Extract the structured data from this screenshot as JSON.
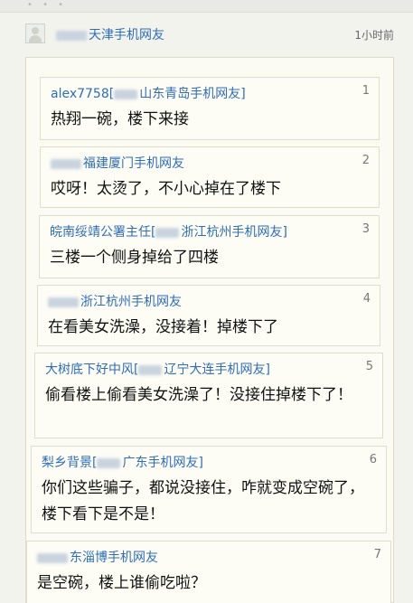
{
  "post": {
    "poster": "天津手机网友",
    "time": "1小时前"
  },
  "comments": [
    {
      "name_prefix": "alex7758[",
      "name_main": "山东青岛手机网友]",
      "number": "1",
      "text": "热翔一碗，楼下来接"
    },
    {
      "name_prefix": "",
      "name_main": "福建厦门手机网友",
      "number": "2",
      "text": "哎呀！太烫了，不小心掉在了楼下"
    },
    {
      "name_prefix": "皖南绥靖公署主任[",
      "name_main": "浙江杭州手机网友]",
      "number": "3",
      "text": "三楼一个侧身掉给了四楼"
    },
    {
      "name_prefix": "",
      "name_main": "浙江杭州手机网友",
      "number": "4",
      "text": "在看美女洗澡，没接着！掉楼下了"
    },
    {
      "name_prefix": "大树底下好中风[",
      "name_main": "辽宁大连手机网友]",
      "number": "5",
      "text": "偷看楼上偷看美女洗澡了！没接住掉楼下了！"
    },
    {
      "name_prefix": "梨乡背景[",
      "name_main": "广东手机网友]",
      "number": "6",
      "text": "你们这些骗子，都说没接住，咋就变成空碗了，楼下看下是不是！"
    },
    {
      "name_prefix": "",
      "name_main": "东淄博手机网友",
      "number": "7",
      "text": "是空碗，楼上谁偷吃啦？"
    }
  ]
}
